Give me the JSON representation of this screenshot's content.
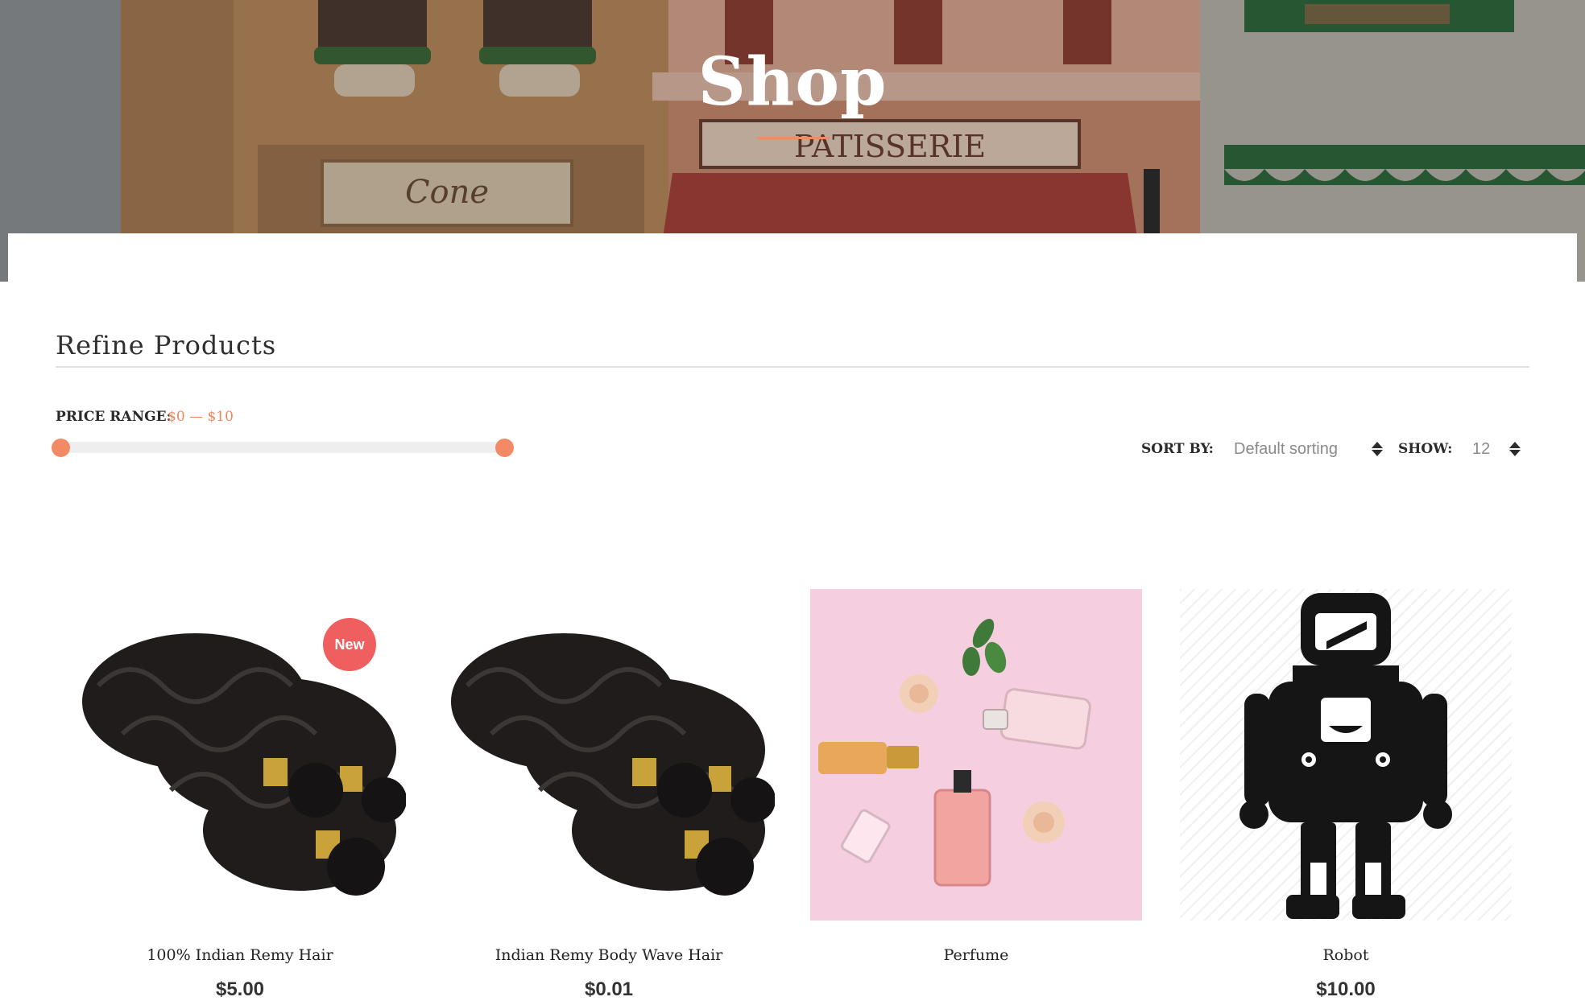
{
  "hero": {
    "title": "Shop",
    "sign_text": "PATISSERIE",
    "shop_sign_text": "Cone"
  },
  "refine": {
    "title": "Refine Products",
    "price_range_label": "PRICE RANGE:",
    "price_range_value": "$0 — $10",
    "slider_min_fraction": 0,
    "slider_max_fraction": 1
  },
  "toolbar": {
    "sort_label": "SORT BY:",
    "sort_value": "Default sorting",
    "show_label": "SHOW:",
    "show_value": "12"
  },
  "products": [
    {
      "name": "100% Indian Remy Hair",
      "price": "$5.00",
      "badge": "New",
      "image": "hair-bundle"
    },
    {
      "name": "Indian Remy Body Wave Hair",
      "price": "$0.01",
      "badge": "",
      "image": "hair-bundle"
    },
    {
      "name": "Perfume",
      "price": "",
      "badge": "",
      "image": "perfume-flatlay"
    },
    {
      "name": "Robot",
      "price": "$10.00",
      "badge": "",
      "image": "robot-icon"
    }
  ],
  "colors": {
    "accent": "#f38a66",
    "badge": "#ef5f5f",
    "perfume_bg": "#f5cfe0"
  }
}
